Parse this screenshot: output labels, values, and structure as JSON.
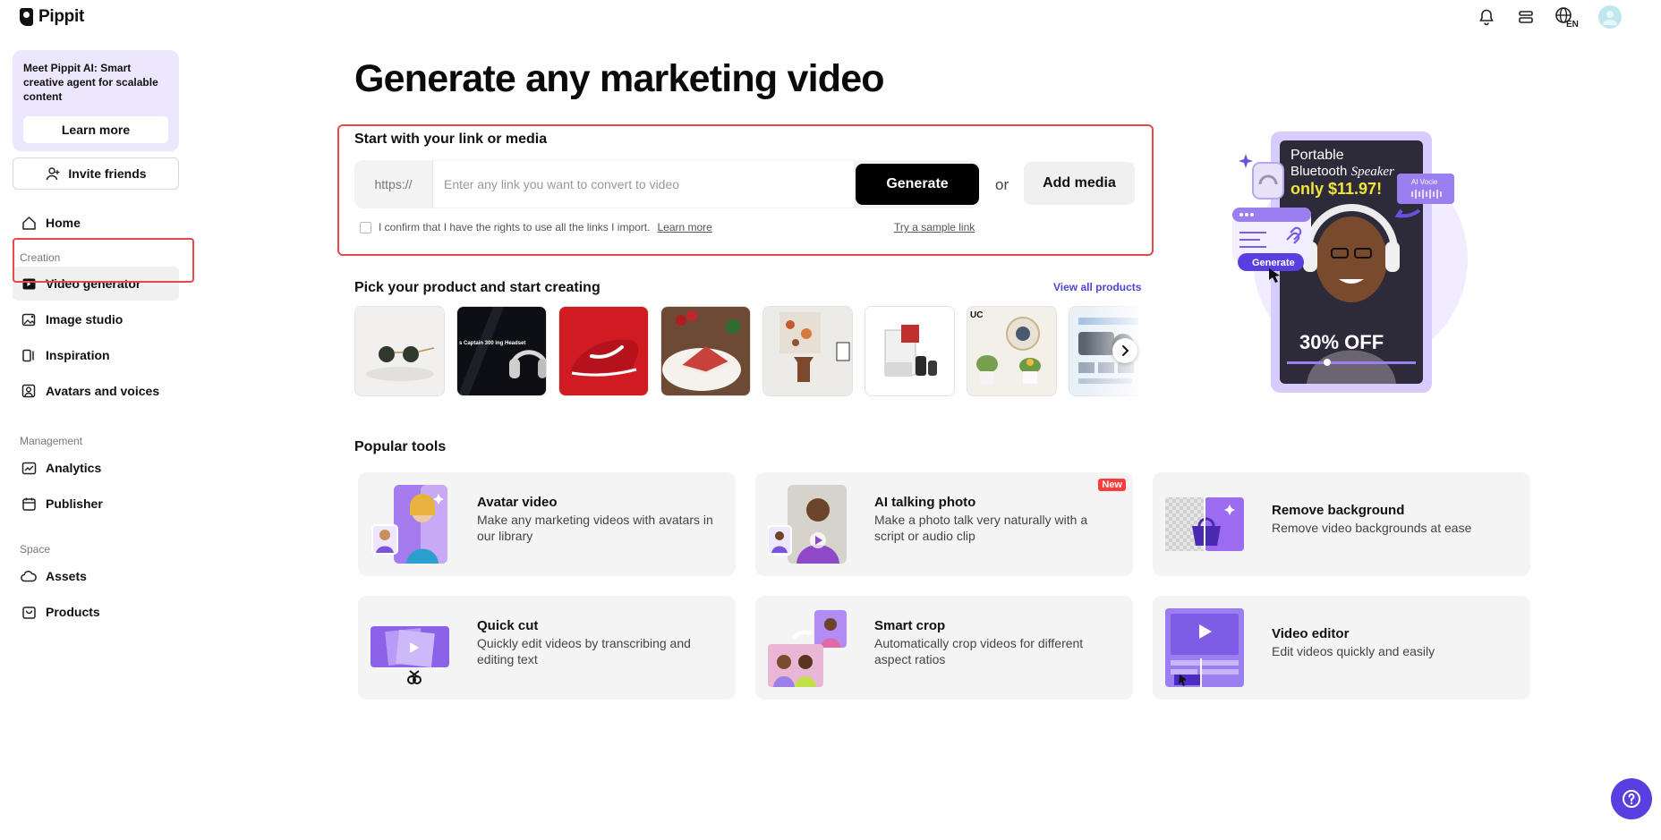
{
  "brand": {
    "name": "Pippit"
  },
  "topbar": {
    "language": "EN"
  },
  "sidebar": {
    "promo_text": "Meet Pippit AI: Smart creative agent for scalable content",
    "promo_button": "Learn more",
    "invite_label": "Invite friends",
    "home": "Home",
    "section_creation": "Creation",
    "creation_items": [
      "Video generator",
      "Image studio",
      "Inspiration",
      "Avatars and voices"
    ],
    "section_management": "Management",
    "management_items": [
      "Analytics",
      "Publisher"
    ],
    "section_space": "Space",
    "space_items": [
      "Assets",
      "Products"
    ]
  },
  "main": {
    "title": "Generate any marketing video",
    "link_box": {
      "title": "Start with your link or media",
      "prefix": "https://",
      "placeholder": "Enter any link you want to convert to video",
      "generate_label": "Generate",
      "or_label": "or",
      "add_media_label": "Add media",
      "confirm_text": "I confirm that I have the rights to use all the links I import.",
      "learn_more": "Learn more",
      "sample_link": "Try a sample link"
    },
    "products": {
      "title": "Pick your product and start creating",
      "view_all": "View all products",
      "item_texts": {
        "headset": "s Captain 300 ing Headset",
        "brand_uc": "UC"
      }
    },
    "popular_tools": {
      "title": "Popular tools",
      "items": [
        {
          "title": "Avatar video",
          "desc": "Make any marketing videos with avatars in our library"
        },
        {
          "title": "AI talking photo",
          "desc": "Make a photo talk very naturally with a script or audio clip",
          "badge": "New"
        },
        {
          "title": "Remove background",
          "desc": "Remove video backgrounds at ease"
        },
        {
          "title": "Quick cut",
          "desc": "Quickly edit videos by transcribing and editing text"
        },
        {
          "title": "Smart crop",
          "desc": "Automatically crop videos for different aspect ratios"
        },
        {
          "title": "Video editor",
          "desc": "Edit videos quickly and easily"
        }
      ]
    },
    "hero": {
      "product_line1": "Portable",
      "product_line2a": "Bluetooth ",
      "product_line2b": "Speaker",
      "price": "only $11.97!",
      "discount": "30% OFF",
      "voice_label": "AI Vocie",
      "generate_label": "Generate"
    }
  },
  "colors": {
    "accent": "#5a3fe0",
    "highlight_border": "#e5484d",
    "promo_bg": "#ece7fd"
  }
}
